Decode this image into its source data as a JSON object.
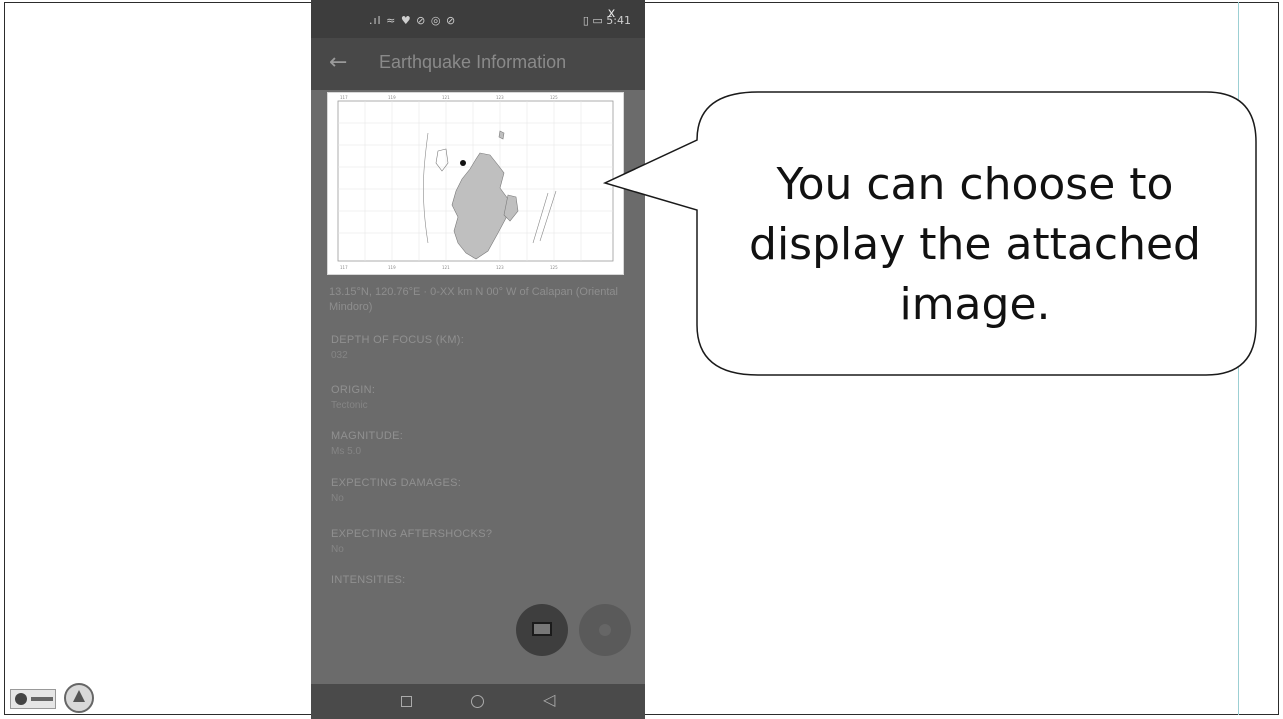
{
  "phone": {
    "status_left": ".ıl ≈ ♥ ⊘ ◎ ⊘",
    "status_right": "▯ ▭ 5:41",
    "close_label": "x",
    "app_bar": {
      "back_icon": "arrow-left-icon",
      "title": "Earthquake Information"
    },
    "location": "13.15°N, 120.76°E · 0-XX km N 00° W of Calapan (Oriental Mindoro)",
    "fields": [
      {
        "label": "DEPTH OF FOCUS (KM):",
        "value": "032"
      },
      {
        "label": "ORIGIN:",
        "value": "Tectonic"
      },
      {
        "label": "MAGNITUDE:",
        "value": "Ms 5.0"
      },
      {
        "label": "EXPECTING DAMAGES:",
        "value": "No"
      },
      {
        "label": "EXPECTING AFTERSHOCKS?",
        "value": "No"
      },
      {
        "label": "INTENSITIES:",
        "value": ""
      }
    ],
    "fab_image_icon": "image-icon",
    "fab_other_icon": "circle-icon",
    "nav": {
      "recent_icon": "square-icon",
      "home_icon": "circle-icon",
      "back_icon": "triangle-back-icon"
    }
  },
  "callout": {
    "text_line1": "You can choose to",
    "text_line2": "display the attached",
    "text_line3": "image."
  },
  "footer": {
    "logo_left": "agency-logo",
    "logo_right": "seal-logo"
  }
}
